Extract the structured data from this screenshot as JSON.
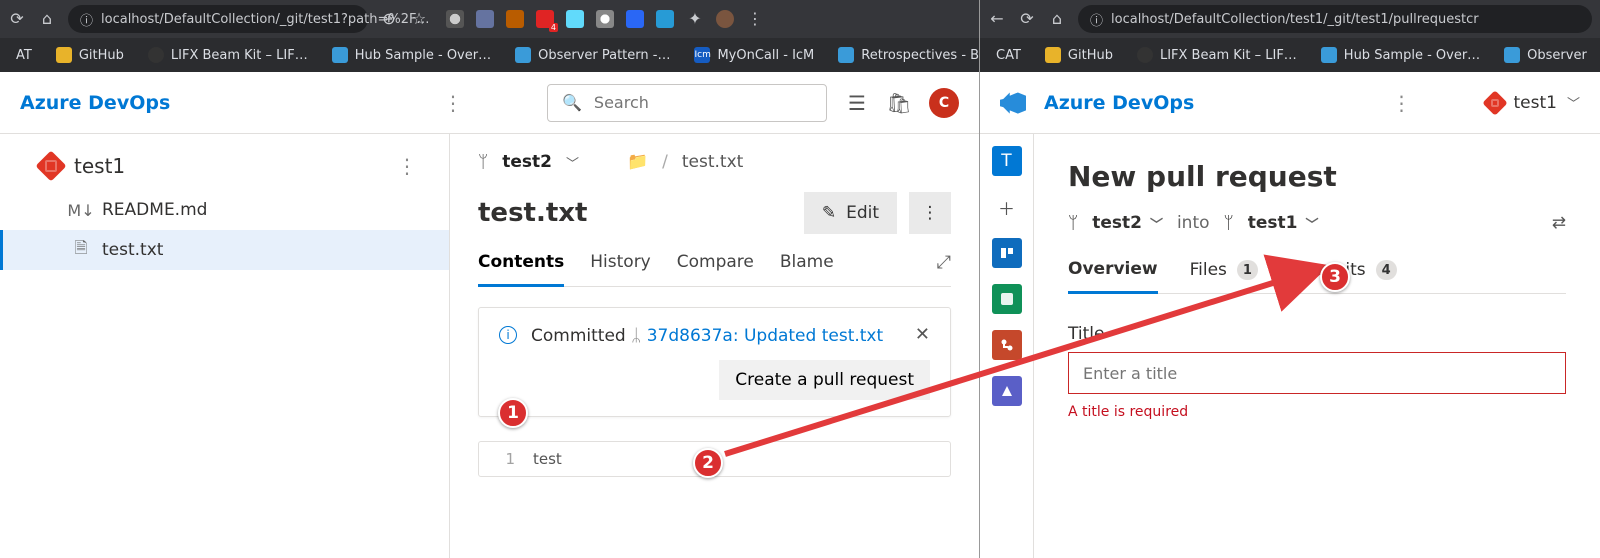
{
  "leftBrowser": {
    "url": "localhost/DefaultCollection/_git/test1?path=%2F…",
    "bookmarks": [
      "AT",
      "GitHub",
      "LIFX Beam Kit – LIF…",
      "Hub Sample - Over…",
      "Observer Pattern -…",
      "MyOnCall - IcM",
      "Retrospectives - Bo…"
    ]
  },
  "leftApp": {
    "logo": "Azure DevOps",
    "searchPlaceholder": "Search",
    "avatar": "C",
    "repo": "test1",
    "files": [
      "README.md",
      "test.txt"
    ],
    "selectedFile": "test.txt",
    "branch": "test2",
    "crumbFolderIcon": "📁",
    "crumbFile": "test.txt",
    "fileTitle": "test.txt",
    "editLabel": "Edit",
    "tabs": [
      "Contents",
      "History",
      "Compare",
      "Blame"
    ],
    "commit": {
      "prefix": "Committed",
      "link": "37d8637a: Updated test.txt",
      "prButton": "Create a pull request"
    },
    "fileContents": "test"
  },
  "rightBrowser": {
    "url": "localhost/DefaultCollection/test1/_git/test1/pullrequestcr",
    "bookmarks": [
      "CAT",
      "GitHub",
      "LIFX Beam Kit – LIF…",
      "Hub Sample - Over…",
      "Observer"
    ]
  },
  "rightApp": {
    "logo": "Azure DevOps",
    "breadcrumbRepo": "test1",
    "railItems": [
      {
        "bg": "#0178d4",
        "txt": "T"
      },
      {
        "bg": "transparent",
        "txt": "＋",
        "fg": "#555"
      },
      {
        "bg": "#0f6cbd",
        "txt": "",
        "icon": "board"
      },
      {
        "bg": "#0f9158",
        "txt": "",
        "icon": "boards"
      },
      {
        "bg": "#c5482b",
        "txt": "",
        "icon": "repos"
      },
      {
        "bg": "#5a5fc7",
        "txt": "",
        "icon": "pipelines"
      }
    ],
    "prHeading": "New pull request",
    "srcBranch": "test2",
    "into": "into",
    "dstBranch": "test1",
    "rtabs": [
      {
        "label": "Overview",
        "count": null,
        "active": true
      },
      {
        "label": "Files",
        "count": "1"
      },
      {
        "label": "Commits",
        "count": "4"
      }
    ],
    "titleLabel": "Title",
    "titlePlaceholder": "Enter a title",
    "titleError": "A title is required"
  },
  "annotations": {
    "n1": "1",
    "n2": "2",
    "n3": "3"
  }
}
